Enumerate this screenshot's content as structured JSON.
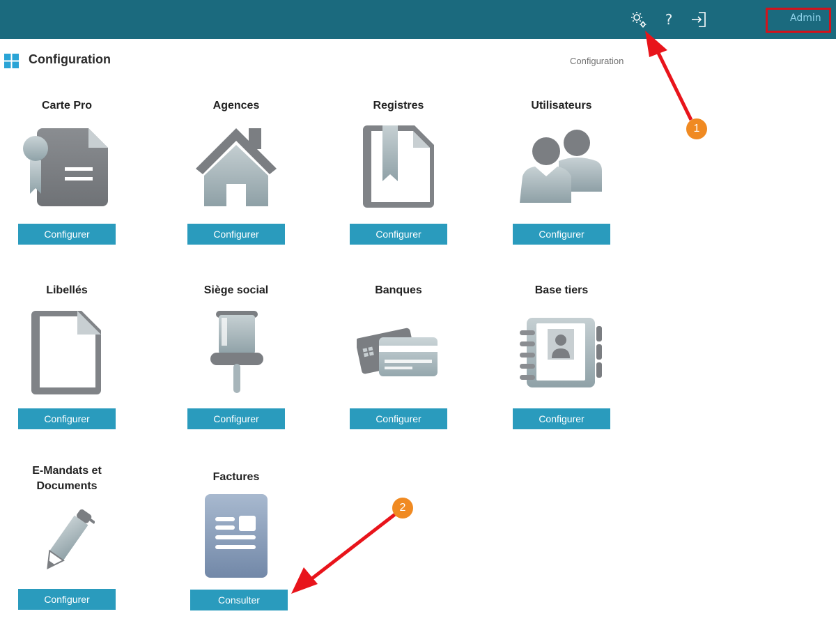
{
  "header": {
    "settings_icon": "gears-icon",
    "help_label": "?",
    "logout_icon": "sign-in-icon",
    "user_label": "Admin",
    "bg_color": "#1b6a7e"
  },
  "page": {
    "title": "Configuration",
    "breadcrumb": "Configuration"
  },
  "tiles": [
    {
      "title": "Carte Pro",
      "button": "Configurer",
      "icon": "certificate-icon"
    },
    {
      "title": "Agences",
      "button": "Configurer",
      "icon": "house-icon"
    },
    {
      "title": "Registres",
      "button": "Configurer",
      "icon": "bookmark-document-icon"
    },
    {
      "title": "Utilisateurs",
      "button": "Configurer",
      "icon": "users-icon"
    },
    {
      "title": "Libellés",
      "button": "Configurer",
      "icon": "blank-document-icon"
    },
    {
      "title": "Siège social",
      "button": "Configurer",
      "icon": "pushpin-icon"
    },
    {
      "title": "Banques",
      "button": "Configurer",
      "icon": "credit-cards-icon"
    },
    {
      "title": "Base tiers",
      "button": "Configurer",
      "icon": "address-book-icon"
    },
    {
      "title_line1": "E-Mandats et",
      "title_line2": "Documents",
      "button": "Configurer",
      "icon": "pen-icon"
    },
    {
      "title": "Factures",
      "button": "Consulter",
      "icon": "invoice-icon"
    }
  ],
  "annotations": {
    "badge1": "1",
    "badge2": "2",
    "arrow_color": "#e8141b",
    "badge_color": "#f08a22"
  },
  "colors": {
    "button": "#2a9bbd",
    "icon_gray": "#7d8084"
  }
}
